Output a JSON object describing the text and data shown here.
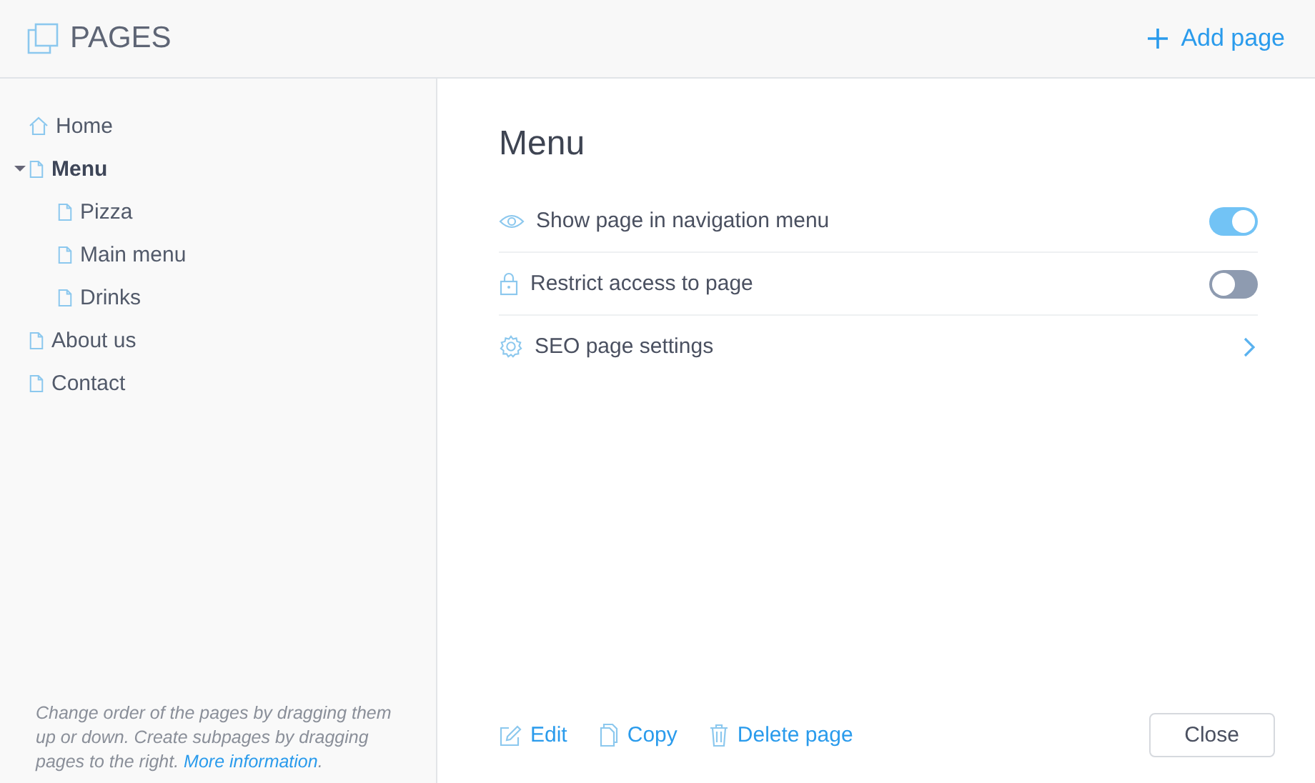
{
  "header": {
    "title": "PAGES",
    "add_button": "Add page"
  },
  "sidebar": {
    "pages": [
      {
        "label": "Home",
        "kind": "home",
        "selected": false
      },
      {
        "label": "Menu",
        "kind": "page",
        "selected": true,
        "expanded": true,
        "children": [
          {
            "label": "Pizza",
            "kind": "page",
            "selected": false
          },
          {
            "label": "Main menu",
            "kind": "page",
            "selected": false
          },
          {
            "label": "Drinks",
            "kind": "page",
            "selected": false
          }
        ]
      },
      {
        "label": "About us",
        "kind": "page",
        "selected": false
      },
      {
        "label": "Contact",
        "kind": "page",
        "selected": false
      }
    ],
    "hint": {
      "text": "Change order of the pages by dragging them up or down. Create subpages by dragging pages to the right. ",
      "link": "More information",
      "end": "."
    }
  },
  "main": {
    "title": "Menu",
    "settings": [
      {
        "kind": "toggle",
        "label": "Show page in navigation menu",
        "on": true
      },
      {
        "kind": "toggle",
        "label": "Restrict access to page",
        "on": false
      },
      {
        "kind": "link",
        "label": "SEO page settings"
      }
    ],
    "actions": [
      {
        "label": "Edit"
      },
      {
        "label": "Copy"
      },
      {
        "label": "Delete page"
      }
    ],
    "close_button": "Close"
  }
}
